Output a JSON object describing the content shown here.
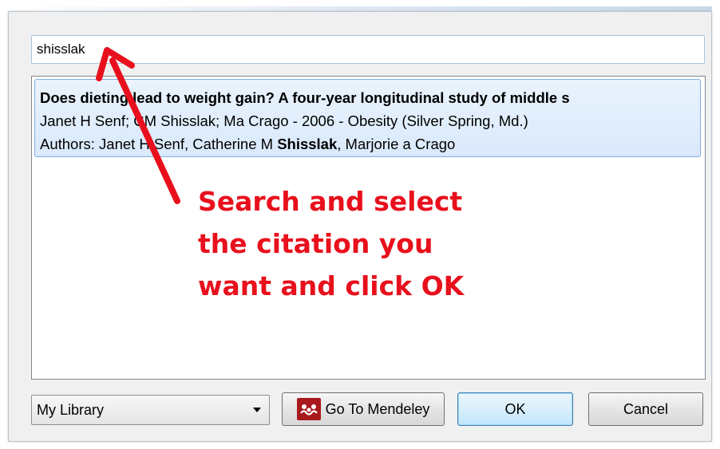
{
  "search": {
    "value": "shisslak"
  },
  "results": [
    {
      "title": "Does dieting lead to weight gain? A four-year longitudinal study of middle s",
      "citation": "Janet H Senf; CM Shisslak; Ma Crago - 2006 - Obesity (Silver Spring, Md.)",
      "authors_prefix": "Authors: Janet H Senf, Catherine M ",
      "authors_highlight": "Shisslak",
      "authors_suffix": ", Marjorie a Crago"
    }
  ],
  "annotation": {
    "lines": [
      "Search and select",
      "the citation you",
      "want and click OK"
    ],
    "color": "#e8101c"
  },
  "footer": {
    "library_selected": "My Library",
    "mendeley_button": "Go To Mendeley",
    "ok_button": "OK",
    "cancel_button": "Cancel"
  },
  "icons": {
    "mendeley": "mendeley-logo-icon",
    "dropdown": "chevron-down-icon",
    "arrow": "red-arrow-annotation"
  },
  "colors": {
    "selection_bg": "#d9e9fb",
    "selection_border": "#84acdd",
    "ok_border": "#3c7fb1",
    "mendeley_red": "#a9191d"
  }
}
